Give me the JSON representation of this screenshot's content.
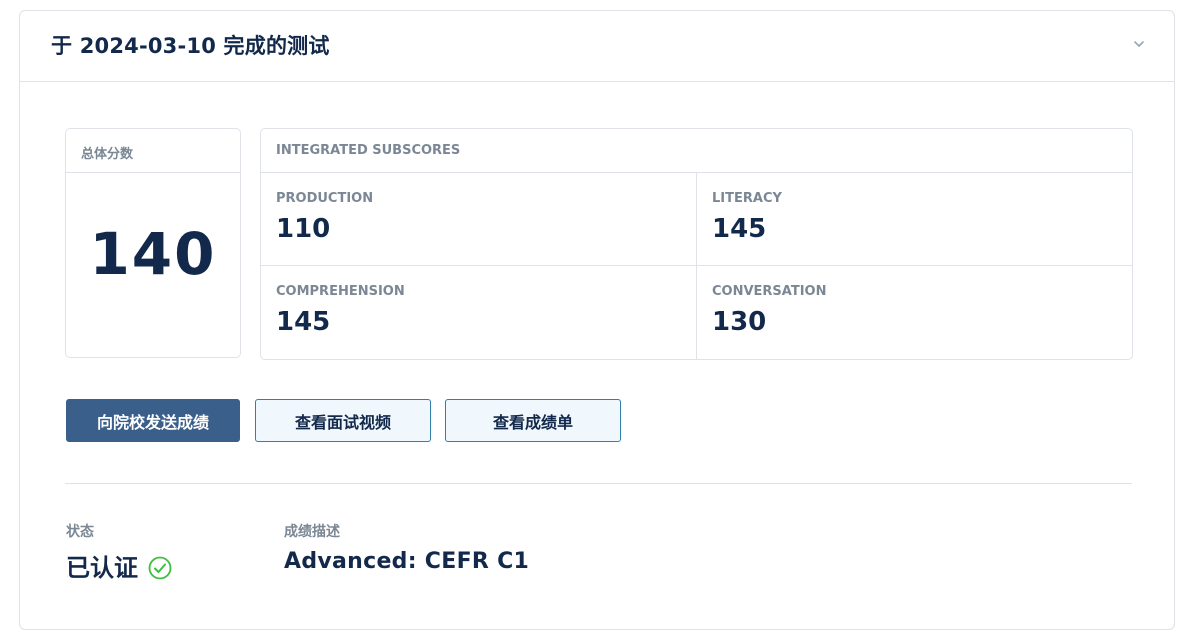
{
  "header": {
    "title": "于 2024-03-10 完成的测试",
    "toggle_icon": "chevron-down-icon"
  },
  "total_score": {
    "label": "总体分数",
    "value": "140"
  },
  "subscores": {
    "label": "INTEGRATED SUBSCORES",
    "items": [
      {
        "name": "PRODUCTION",
        "value": "110"
      },
      {
        "name": "LITERACY",
        "value": "145"
      },
      {
        "name": "COMPREHENSION",
        "value": "145"
      },
      {
        "name": "CONVERSATION",
        "value": "130"
      }
    ]
  },
  "actions": {
    "send_label": "向院校发送成绩",
    "video_label": "查看面试视频",
    "transcript_label": "查看成绩单"
  },
  "status": {
    "label": "状态",
    "value": "已认证",
    "icon": "check-circle-icon"
  },
  "description": {
    "label": "成绩描述",
    "value": "Advanced: CEFR C1"
  },
  "colors": {
    "primary": "#3a5f8a",
    "text_dark": "#13294b",
    "muted": "#7b8794",
    "border": "#dfe3e8",
    "success": "#3fbf3f",
    "outline_border": "#2f7fa8",
    "outline_bg": "#f1f8fd"
  }
}
